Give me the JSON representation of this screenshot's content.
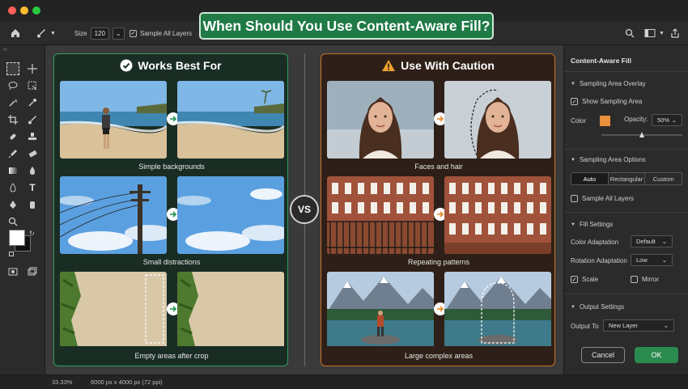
{
  "banner": {
    "title": "When Should You Use Content-Aware Fill?"
  },
  "options_bar": {
    "size_label": "Size",
    "size_value": "120",
    "sample_all_layers": "Sample All Layers"
  },
  "left_panel": {
    "title": "Works Best For",
    "rows": [
      {
        "caption": "Simple backgrounds"
      },
      {
        "caption": "Small distractions"
      },
      {
        "caption": "Empty areas after crop"
      }
    ]
  },
  "vs_label": "VS",
  "right_panel_compare": {
    "title": "Use With Caution",
    "rows": [
      {
        "caption": "Faces and hair"
      },
      {
        "caption": "Repeating patterns"
      },
      {
        "caption": "Large complex areas"
      }
    ]
  },
  "caf_panel": {
    "title": "Content-Aware Fill",
    "sampling_overlay": "Sampling Area Overlay",
    "show_sampling_area": "Show Sampling Area",
    "color_label": "Color",
    "opacity_label": "Opacity:",
    "opacity_value": "50%",
    "opacity_level": 0.5,
    "sampling_options": "Sampling Area Options",
    "seg": [
      "Auto",
      "Rectangular",
      "Custom"
    ],
    "sample_all_layers": "Sample All Layers",
    "fill_settings": "Fill Settings",
    "color_adaptation": "Color Adaptation",
    "color_adaptation_value": "Default",
    "rotation_adaptation": "Rotation Adaptation",
    "rotation_adaptation_value": "Low",
    "scale": "Scale",
    "mirror": "Mirror",
    "output_settings": "Output Settings",
    "output_to": "Output To",
    "output_to_value": "New Layer",
    "cancel": "Cancel",
    "ok": "OK"
  },
  "status": {
    "zoom": "33.33%",
    "doc": "6000 px x 4000 px (72 ppi)"
  },
  "colors": {
    "accent_green": "#1f7a46",
    "warn_orange": "#c6722a",
    "sample_color": "#e8903a"
  }
}
